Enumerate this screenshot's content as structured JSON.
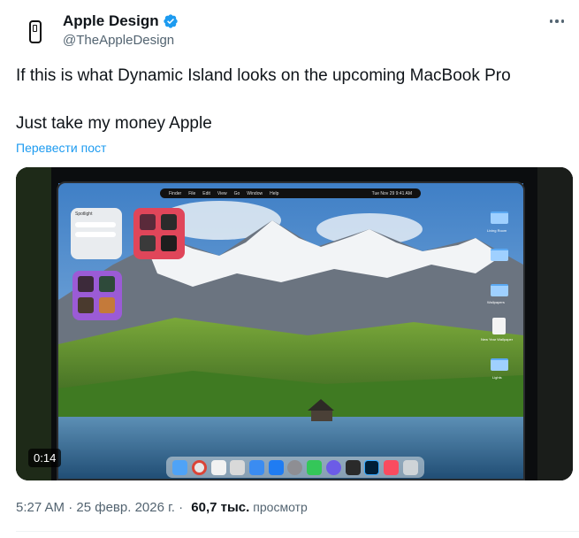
{
  "author": {
    "name": "Apple Design",
    "handle": "@TheAppleDesign",
    "avatar_icon": "phone-outline-icon",
    "verified_icon": "verified-badge-icon",
    "verified_color": "#1d9bf0"
  },
  "more_icon": "more-horizontal-icon",
  "post": {
    "line1": "If this is what Dynamic Island looks on the upcoming MacBook Pro",
    "line2": "Just take my money Apple",
    "translate_label": "Перевести пост"
  },
  "video": {
    "duration": "0:14",
    "menu_bar_items": [
      "Finder",
      "File",
      "Edit",
      "View",
      "Go",
      "Window",
      "Help"
    ],
    "menu_bar_clock": "Tue Nov 29  9:41 AM",
    "desktop_items": [
      "Living Room",
      "",
      "Wallpapers",
      "New Year Wallpaper",
      "Lights"
    ],
    "widget_title": "Spotlight"
  },
  "meta": {
    "time": "5:27 AM",
    "separator": " · ",
    "date": "25 февр. 2026 г.",
    "separator2": " · ",
    "views_count": "60,7 тыс.",
    "views_label": "просмотр"
  },
  "colors": {
    "text_primary": "#0f1419",
    "text_secondary": "#536471",
    "link": "#1d9bf0"
  }
}
